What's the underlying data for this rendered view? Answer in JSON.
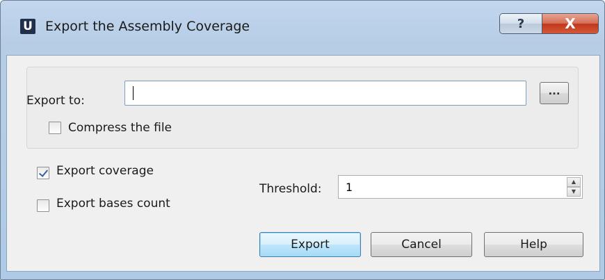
{
  "window": {
    "title": "Export the Assembly Coverage",
    "app_icon_letter": "U",
    "help_glyph": "?",
    "close_glyph": "X"
  },
  "export_to": {
    "label": "Export to:",
    "value": "",
    "browse_label": "..."
  },
  "compress": {
    "label": "Compress the file",
    "checked": false
  },
  "export_coverage": {
    "label": "Export coverage",
    "checked": true
  },
  "export_bases_count": {
    "label": "Export bases count",
    "checked": false
  },
  "threshold": {
    "label": "Threshold:",
    "value": "1",
    "up_glyph": "▲",
    "down_glyph": "▼"
  },
  "buttons": {
    "export": "Export",
    "cancel": "Cancel",
    "help": "Help"
  }
}
